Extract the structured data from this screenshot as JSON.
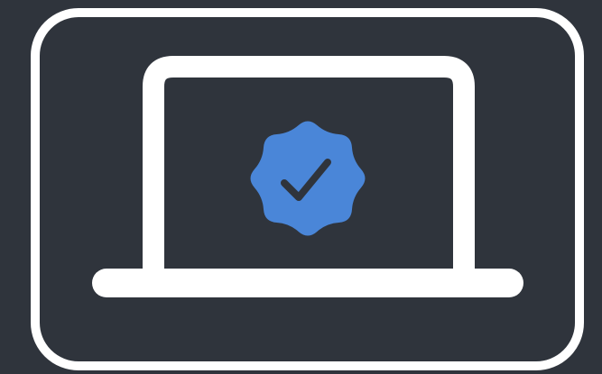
{
  "illustration": {
    "icons": {
      "frame": "rounded-frame-icon",
      "device": "laptop-icon",
      "badge": "verified-badge-icon",
      "check": "checkmark-icon"
    },
    "colors": {
      "background": "#2f343c",
      "outline": "#ffffff",
      "badge": "#4a86d8",
      "check": "#2f343c"
    }
  }
}
